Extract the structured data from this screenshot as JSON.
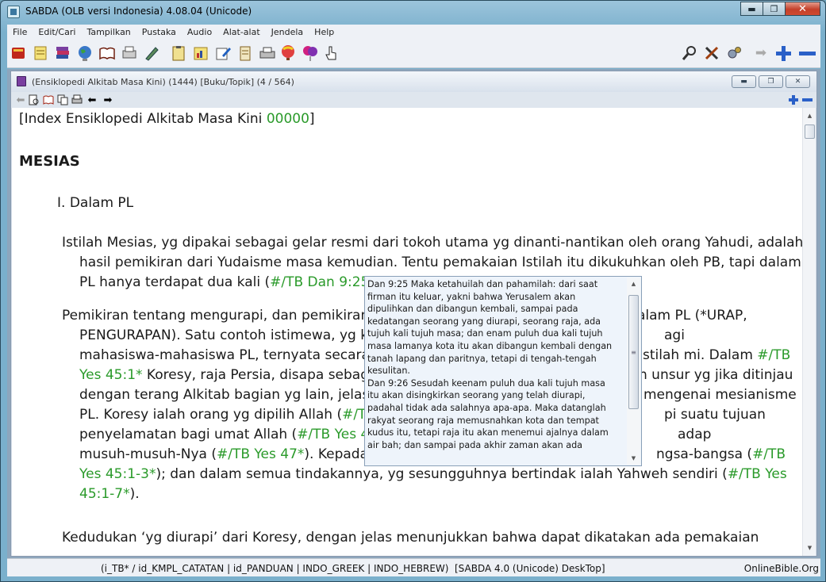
{
  "window": {
    "title": "SABDA (OLB versi Indonesia) 4.08.04  (Unicode)",
    "minimize": "▬",
    "maximize": "❐",
    "close": "✕"
  },
  "menu": [
    "File",
    "Edit/Cari",
    "Tampilkan",
    "Pustaka",
    "Audio",
    "Alat-alat",
    "Jendela",
    "Help"
  ],
  "toolbar_icons": [
    "bible-icon",
    "notes-icon",
    "books-icon",
    "globe-icon",
    "open-book-icon",
    "print-preview-icon",
    "pen-icon",
    "clipboard-icon",
    "chart-icon",
    "edit-icon",
    "scroll-icon",
    "printer-icon",
    "balloon-icon",
    "balloons-icon",
    "hand-pointer-icon",
    "search-tools-icon",
    "tools-icon",
    "gears-icon",
    "arrow-right-icon",
    "zoom-in-icon",
    "zoom-out-icon"
  ],
  "child_window": {
    "title": "(Ensiklopedi Alkitab Masa Kini) (1444) [Buku/Topik] (4 / 564)"
  },
  "content": {
    "index_prefix": "[Index Ensiklopedi Alkitab Masa Kini ",
    "index_code": "00000",
    "index_suffix": "]",
    "heading": "MESIAS",
    "section": "I. Dalam PL",
    "p1_l1": "Istilah Mesias, yg dipakai sebagai gelar resmi dari tokoh utama yg dinanti-nantikan oleh orang Yahudi, adalah",
    "p1_l2": "hasil pemikiran dari Yudaisme masa kemudian. Tentu pemakaian Istilah itu dikukuhkan oleh PB, tapi dalam",
    "p1_l3a": "PL hanya terdapat dua kali (",
    "p1_l3b": "#/TB Dan 9:25-26*",
    "p2_l1a": "Pemikiran tentang mengurapi, dan pemikiran",
    "p2_l1b": "alam PL (*URAP,",
    "p2_l2a": "PENGURAPAN). Satu contoh istimewa, yg k",
    "p2_l2b": "agi",
    "p2_l3a": "mahasiswa-mahasiswa PL, ternyata secara",
    "p2_l3b": " Istilah mi. Dalam ",
    "p2_l3c": "#/TB",
    "p2_l4a": "Yes 45:1*",
    "p2_l4b": " Koresy, raja Persia, disapa sebaga",
    "p2_l4c": "n unsur yg jika ditinjau",
    "p2_l5a": "dengan terang Alkitab bagian yg lain, jelas",
    "p2_l5b": "mengenai mesianisme",
    "p2_l6a": "PL. Koresy ialah orang yg dipilih Allah (",
    "p2_l6b": "#/TE",
    "p2_l6c": "pi suatu tujuan",
    "p2_l7a": "penyelamatan bagi umat Allah (",
    "p2_l7b": "#/TB Yes 45",
    "p2_l7c": "adap",
    "p2_l8a": "musuh-musuh-Nya (",
    "p2_l8b": "#/TB Yes 47*",
    "p2_l8c": "). Kepada",
    "p2_l8d": "ngsa-bangsa (",
    "p2_l8e": "#/TB",
    "p2_l9a": "Yes 45:1-3*",
    "p2_l9b": "); dan dalam semua tindakannya, yg sesungguhnya bertindak ialah Yahweh sendiri (",
    "p2_l9c": "#/TB Yes",
    "p2_l10a": "45:1-7*",
    "p2_l10b": ").",
    "p3_l1": "Kedudukan ‘yg diurapi’ dari Koresy, dengan jelas menunjukkan bahwa dapat dikatakan ada pemakaian"
  },
  "popup": {
    "lines": [
      "Dan 9:25  Maka ketahuilah dan pahamilah: dari saat",
      "firman itu keluar, yakni bahwa Yerusalem akan",
      "dipulihkan dan dibangun kembali, sampai pada",
      "kedatangan seorang yang diurapi, seorang raja, ada",
      "tujuh kali tujuh masa; dan enam puluh dua kali tujuh",
      "masa lamanya kota itu akan dibangun kembali dengan",
      "tanah lapang dan paritnya, tetapi di tengah-tengah",
      "kesulitan.",
      "Dan 9:26  Sesudah keenam puluh dua kali tujuh masa",
      "itu akan disingkirkan seorang yang telah diurapi,",
      "padahal tidak ada salahnya apa-apa. Maka datanglah",
      "rakyat seorang raja memusnahkan kota dan tempat",
      "kudus itu, tetapi raja itu akan menemui ajalnya dalam",
      "air bah; dan sampai pada akhir zaman akan ada"
    ]
  },
  "status": {
    "modules": "(i_TB* / id_KMPL_CATATAN | id_PANDUAN | INDO_GREEK | INDO_HEBREW)",
    "product": "[SABDA 4.0 (Unicode) DeskTop]",
    "site": "OnlineBible.Org"
  },
  "colors": {
    "link": "#2a9a2a"
  }
}
